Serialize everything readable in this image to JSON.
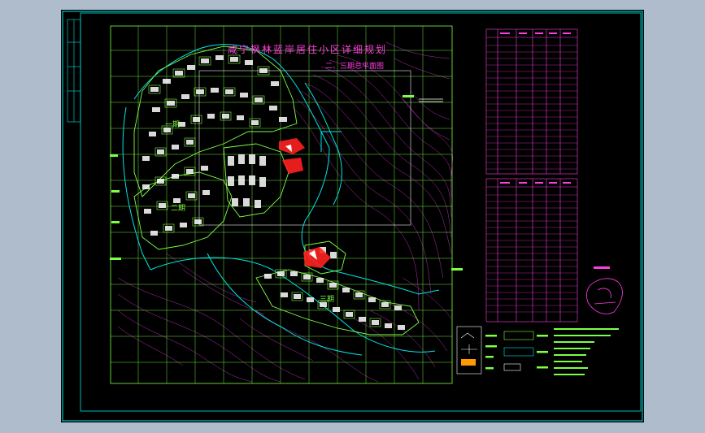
{
  "drawing": {
    "title": "咸宁枫林蓝岸居住小区详细规划",
    "subtitle": "二、三期总平面图",
    "phase_labels": [
      "一期",
      "二期",
      "三期"
    ]
  },
  "colors": {
    "background": "#aebccb",
    "sheet": "#000000",
    "frame": "#00e5e5",
    "grid": "#7dff44",
    "contour": "#d83ad8",
    "road": "#00e5e5",
    "building": "#ffffff",
    "accent": "#ff2020",
    "table": "#ff3de0"
  }
}
